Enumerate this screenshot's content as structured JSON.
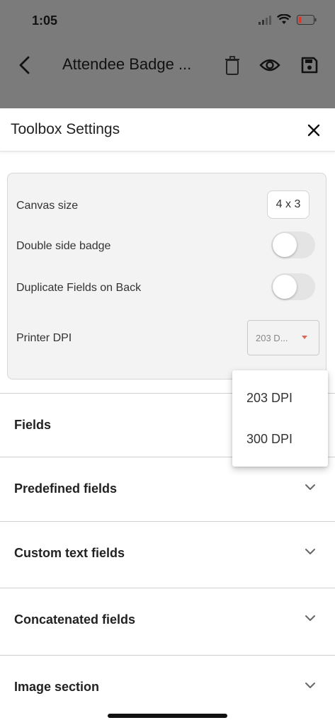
{
  "status_bar": {
    "time": "1:05"
  },
  "app_bar": {
    "title": "Attendee Badge ..."
  },
  "sheet": {
    "title": "Toolbox Settings",
    "settings": {
      "canvas_size_label": "Canvas size",
      "canvas_size_value": "4 x 3",
      "double_side_label": "Double side badge",
      "double_side_on": false,
      "duplicate_fields_label": "Duplicate Fields on Back",
      "duplicate_fields_on": false,
      "printer_dpi_label": "Printer DPI",
      "printer_dpi_value": "203 D..."
    },
    "sections": [
      {
        "label": "Fields"
      },
      {
        "label": "Predefined fields"
      },
      {
        "label": "Custom text fields"
      },
      {
        "label": "Concatenated fields"
      },
      {
        "label": "Image section"
      }
    ],
    "dpi_options": [
      "203 DPI",
      "300 DPI"
    ]
  },
  "colors": {
    "overlay": "#7b7b7b",
    "card_bg": "#f3f3f3",
    "dropdown_arrow": "#d86a5a"
  }
}
